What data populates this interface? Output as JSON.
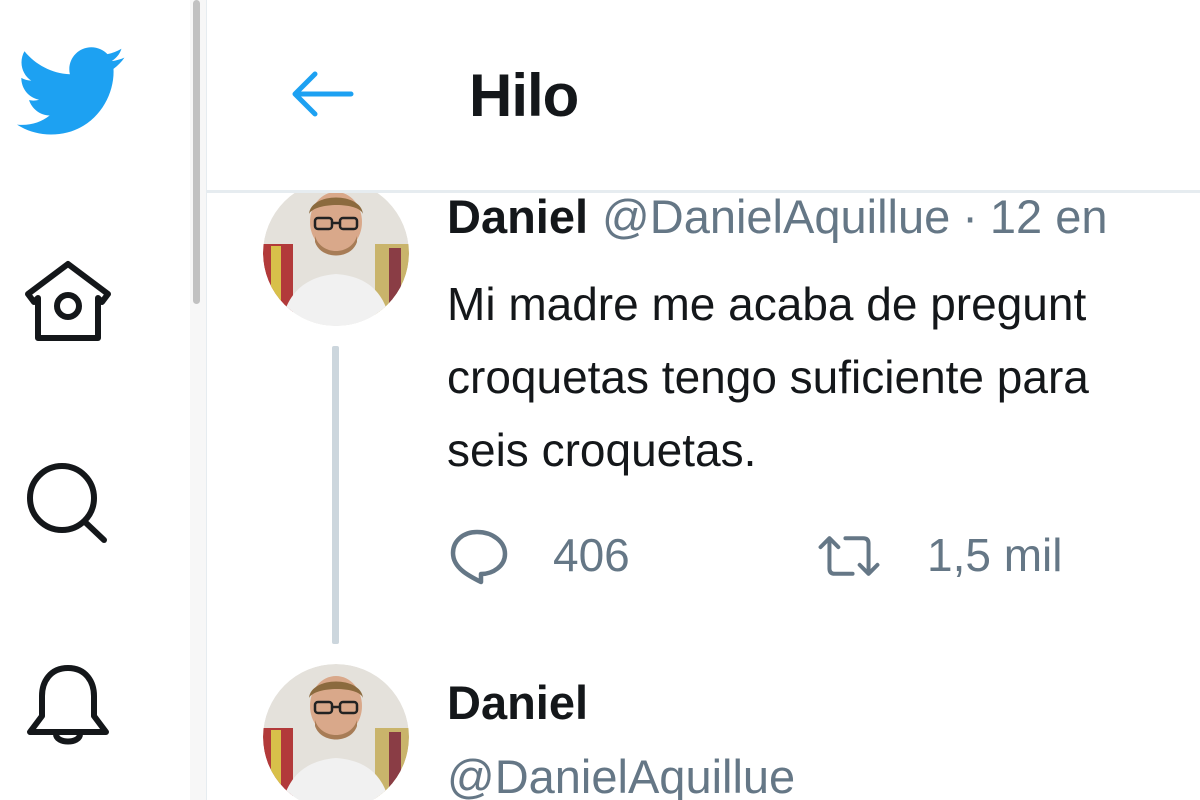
{
  "header": {
    "title": "Hilo",
    "back_icon": "back-arrow-icon"
  },
  "nav": {
    "items": [
      {
        "name": "twitter-logo",
        "icon": "bird-icon"
      },
      {
        "name": "home",
        "icon": "home-icon"
      },
      {
        "name": "explore",
        "icon": "search-icon"
      },
      {
        "name": "notifications",
        "icon": "bell-icon"
      }
    ]
  },
  "colors": {
    "brand": "#1da1f2",
    "text_primary": "#14171a",
    "text_secondary": "#657786",
    "thread_line": "#ccd6dd",
    "divider": "#e6ecf0"
  },
  "tweets": [
    {
      "name": "Daniel",
      "handle": "@DanielAquillue",
      "separator": "·",
      "time": "12 en",
      "text_lines": [
        "Mi madre me acaba de pregunt",
        "croquetas tengo suficiente para",
        "seis croquetas."
      ],
      "reply_count": "406",
      "retweet_count": "1,5 mil"
    },
    {
      "name": "Daniel",
      "handle": "@DanielAquillue"
    }
  ]
}
